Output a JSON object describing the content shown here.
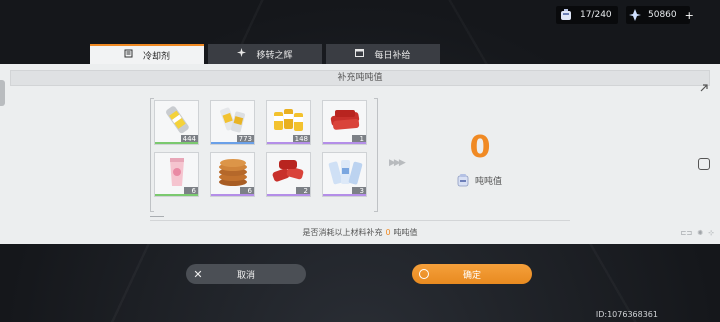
{
  "topbar": {
    "stamina": {
      "icon": "stamina-pack-icon",
      "value": "17/240"
    },
    "coins": {
      "icon": "crystal-icon",
      "value": "50860",
      "add_label": "+"
    }
  },
  "tabs": [
    {
      "icon": "coolant-tab-icon",
      "label": "冷却剂",
      "active": true
    },
    {
      "icon": "transfer-tab-icon",
      "label": "移转之辉",
      "active": false
    },
    {
      "icon": "calendar-tab-icon",
      "label": "每日补给",
      "active": false
    }
  ],
  "panel": {
    "title": "补充吨吨值",
    "items": [
      {
        "name": "item-lemon-can",
        "count": "444",
        "rarity": "green"
      },
      {
        "name": "item-gold-cans",
        "count": "773",
        "rarity": "blue"
      },
      {
        "name": "item-gold-cans-pack",
        "count": "148",
        "rarity": "purple"
      },
      {
        "name": "item-red-cans",
        "count": "1",
        "rarity": "purple"
      },
      {
        "name": "item-pink-drink",
        "count": "6",
        "rarity": "green"
      },
      {
        "name": "item-cookies",
        "count": "6",
        "rarity": "purple"
      },
      {
        "name": "item-red-cans-pack",
        "count": "2",
        "rarity": "purple"
      },
      {
        "name": "item-blue-cans",
        "count": "3",
        "rarity": "purple"
      }
    ],
    "result_value": "0",
    "result_label": "吨吨值",
    "confirm_prefix": "是否消耗以上材料补充",
    "confirm_amount": "0",
    "confirm_suffix": "吨吨值"
  },
  "buttons": {
    "cancel_label": "取消",
    "ok_label": "确定"
  },
  "uid": "ID:1076368361",
  "colors": {
    "accent": "#f08a24",
    "panel": "#eceeef",
    "background": "#1c1f24"
  }
}
